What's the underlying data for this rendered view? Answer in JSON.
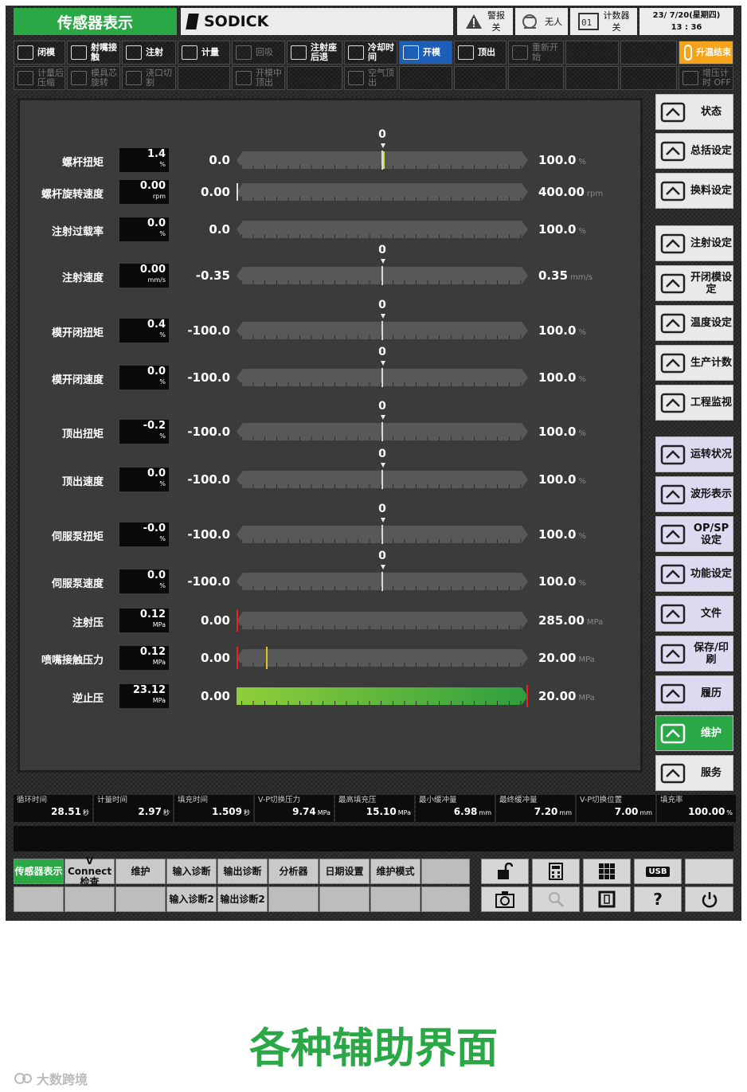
{
  "header": {
    "screen_title": "传感器表示",
    "brand": "SODICK",
    "alarm": {
      "label": "警报",
      "value": "关"
    },
    "operator": {
      "label": "无人"
    },
    "counter": {
      "label": "计数器",
      "value": "关"
    },
    "datetime": {
      "date": "23/ 7/20(星期四)",
      "time": "13 : 36"
    }
  },
  "toolbar": {
    "row1": [
      "闭模",
      "射嘴接触",
      "注射",
      "计量",
      "回吸",
      "注射座后退",
      "冷却时间",
      "开模",
      "顶出",
      "重新开始",
      "",
      "",
      "升温结束"
    ],
    "row2": [
      "计量后压缩",
      "模具芯旋转",
      "浇口切割",
      "",
      "开模中顶出",
      "",
      "空气顶出",
      "",
      "",
      "",
      "",
      "",
      "增压计时 OFF"
    ]
  },
  "sensors": [
    {
      "label": "螺杆扭矩",
      "value": "1.4",
      "unit": "%",
      "min": "0.0",
      "max": "100.0",
      "max_unit": "%",
      "zero_label": "0",
      "frac": 0.014
    },
    {
      "label": "螺杆旋转速度",
      "value": "0.00",
      "unit": "rpm",
      "min": "0.00",
      "max": "400.00",
      "max_unit": "rpm",
      "zero_label": "",
      "frac": 0
    },
    {
      "label": "注射过载率",
      "value": "0.0",
      "unit": "%",
      "min": "0.0",
      "max": "100.0",
      "max_unit": "%",
      "zero_label": "",
      "frac": 0
    },
    {
      "label": "注射速度",
      "value": "0.00",
      "unit": "mm/s",
      "min": "-0.35",
      "max": "0.35",
      "max_unit": "mm/s",
      "zero_label": "0",
      "frac": 0.5
    },
    {
      "label": "模开闭扭矩",
      "value": "0.4",
      "unit": "%",
      "min": "-100.0",
      "max": "100.0",
      "max_unit": "%",
      "zero_label": "0",
      "frac": 0.5
    },
    {
      "label": "模开闭速度",
      "value": "0.0",
      "unit": "%",
      "min": "-100.0",
      "max": "100.0",
      "max_unit": "%",
      "zero_label": "0",
      "frac": 0.5
    },
    {
      "label": "顶出扭矩",
      "value": "-0.2",
      "unit": "%",
      "min": "-100.0",
      "max": "100.0",
      "max_unit": "%",
      "zero_label": "0",
      "frac": 0.5
    },
    {
      "label": "顶出速度",
      "value": "0.0",
      "unit": "%",
      "min": "-100.0",
      "max": "100.0",
      "max_unit": "%",
      "zero_label": "0",
      "frac": 0.5
    },
    {
      "label": "伺服泵扭矩",
      "value": "-0.0",
      "unit": "%",
      "min": "-100.0",
      "max": "100.0",
      "max_unit": "%",
      "zero_label": "0",
      "frac": 0.5
    },
    {
      "label": "伺服泵速度",
      "value": "0.0",
      "unit": "%",
      "min": "-100.0",
      "max": "100.0",
      "max_unit": "%",
      "zero_label": "0",
      "frac": 0.5
    },
    {
      "label": "注射压",
      "value": "0.12",
      "unit": "MPa",
      "min": "0.00",
      "max": "285.00",
      "max_unit": "MPa",
      "zero_label": "",
      "frac": 0
    },
    {
      "label": "喷嘴接触压力",
      "value": "0.12",
      "unit": "MPa",
      "min": "0.00",
      "max": "20.00",
      "max_unit": "MPa",
      "zero_label": "",
      "frac": 0,
      "setpoint_frac": 0.1
    },
    {
      "label": "逆止压",
      "value": "23.12",
      "unit": "MPa",
      "min": "0.00",
      "max": "20.00",
      "max_unit": "MPa",
      "zero_label": "",
      "frac": 1
    }
  ],
  "side_menu": [
    "状态",
    "总括设定",
    "换料设定",
    "注射设定",
    "开闭模设定",
    "温度设定",
    "生产计数",
    "工程监视",
    "运转状况",
    "波形表示",
    "OP/SP设定",
    "功能设定",
    "文件",
    "保存/印刷",
    "履历",
    "维护",
    "服务"
  ],
  "stats": [
    {
      "label": "循环时间",
      "value": "28.51",
      "unit": "秒"
    },
    {
      "label": "计量时间",
      "value": "2.97",
      "unit": "秒"
    },
    {
      "label": "填充时间",
      "value": "1.509",
      "unit": "秒"
    },
    {
      "label": "V-P切换压力",
      "value": "9.74",
      "unit": "MPa"
    },
    {
      "label": "最高填充压",
      "value": "15.10",
      "unit": "MPa"
    },
    {
      "label": "最小缓冲量",
      "value": "6.98",
      "unit": "mm"
    },
    {
      "label": "最终缓冲量",
      "value": "7.20",
      "unit": "mm"
    },
    {
      "label": "V-P切换位置",
      "value": "7.00",
      "unit": "mm"
    },
    {
      "label": "填充率",
      "value": "100.00",
      "unit": "%"
    }
  ],
  "bottom_tabs": {
    "row1": [
      "传感器表示",
      "V Connect检查",
      "维护",
      "输入诊断",
      "输出诊断",
      "分析器",
      "日期设置",
      "维护模式",
      ""
    ],
    "row2": [
      "",
      "",
      "",
      "输入诊断2",
      "输出诊断2",
      "",
      "",
      "",
      ""
    ]
  },
  "utility_buttons": [
    "USB",
    "?"
  ],
  "caption": "各种辅助界面",
  "watermark": "大数跨境"
}
